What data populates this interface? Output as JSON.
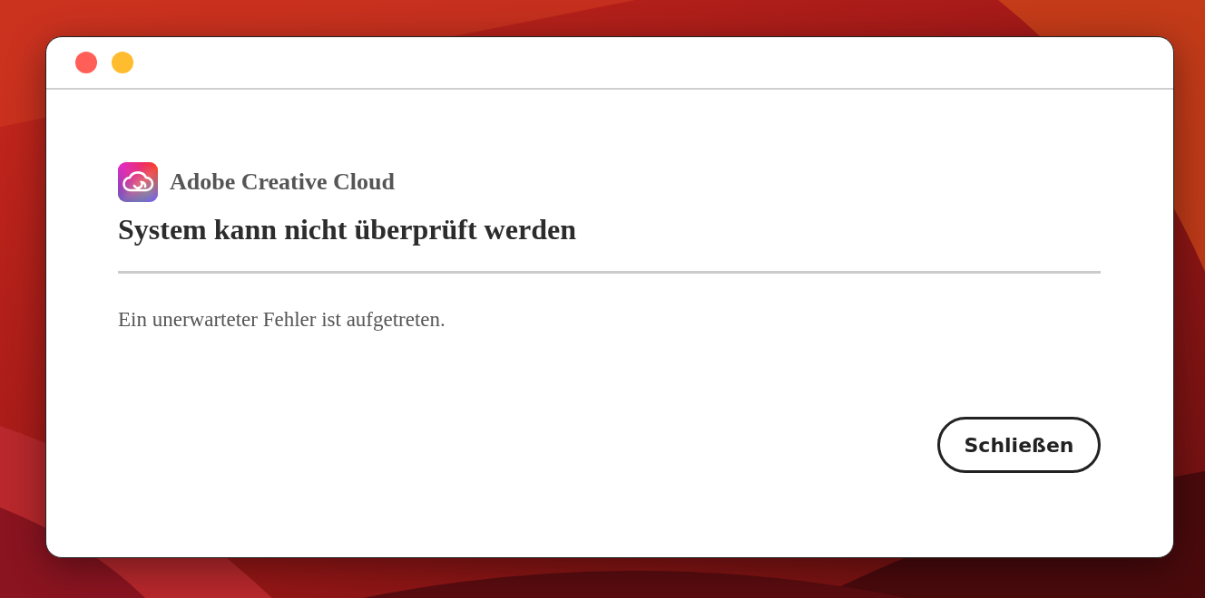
{
  "window": {
    "controls": [
      {
        "kind": "close"
      },
      {
        "kind": "minimize"
      }
    ]
  },
  "dialog": {
    "app_name": "Adobe Creative Cloud",
    "title": "System kann nicht überprüft werden",
    "message": "Ein unerwarteter Fehler ist aufgetreten.",
    "buttons": [
      "Schließen"
    ]
  }
}
